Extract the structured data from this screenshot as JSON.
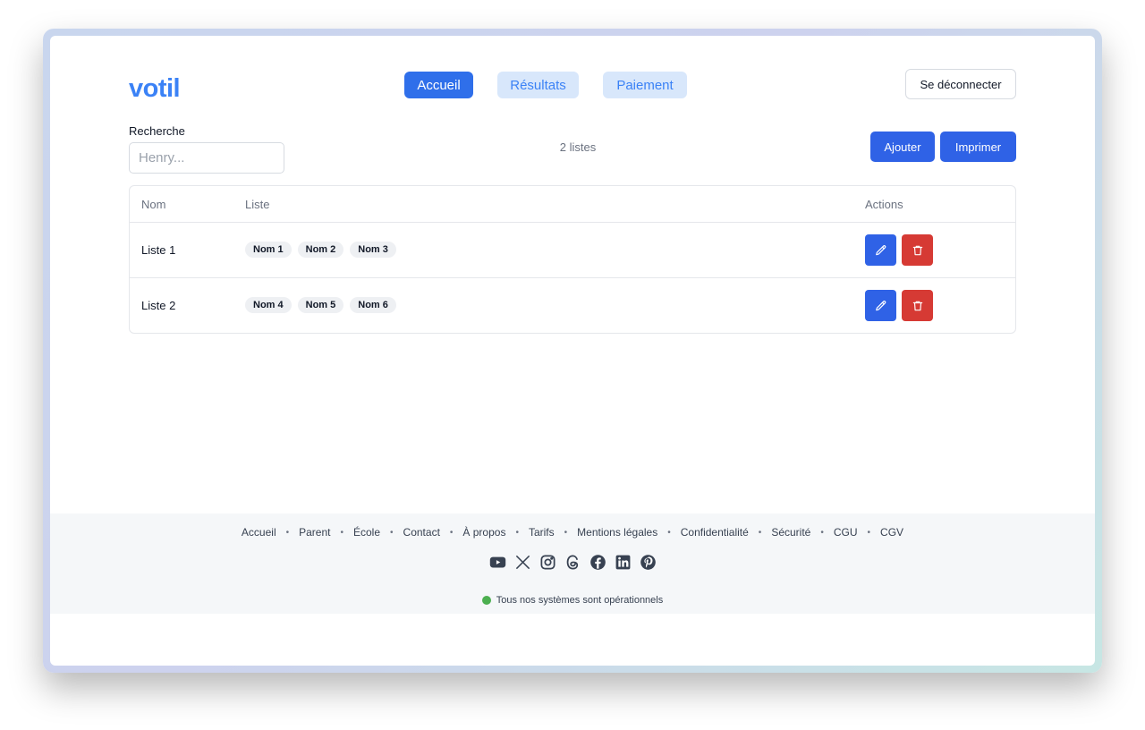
{
  "header": {
    "logo": "votil",
    "nav": [
      {
        "label": "Accueil",
        "active": true
      },
      {
        "label": "Résultats",
        "active": false
      },
      {
        "label": "Paiement",
        "active": false
      }
    ],
    "logout_label": "Se déconnecter"
  },
  "toolbar": {
    "search_label": "Recherche",
    "search_placeholder": "Henry...",
    "count_text": "2 listes",
    "add_label": "Ajouter",
    "print_label": "Imprimer"
  },
  "table": {
    "columns": [
      "Nom",
      "Liste",
      "Actions"
    ],
    "rows": [
      {
        "name": "Liste 1",
        "members": [
          "Nom 1",
          "Nom 2",
          "Nom 3"
        ]
      },
      {
        "name": "Liste 2",
        "members": [
          "Nom 4",
          "Nom 5",
          "Nom 6"
        ]
      }
    ]
  },
  "footer": {
    "links": [
      "Accueil",
      "Parent",
      "École",
      "Contact",
      "À propos",
      "Tarifs",
      "Mentions légales",
      "Confidentialité",
      "Sécurité",
      "CGU",
      "CGV"
    ],
    "social_icons": [
      "youtube-icon",
      "x-icon",
      "instagram-icon",
      "threads-icon",
      "facebook-icon",
      "linkedin-icon",
      "pinterest-icon"
    ],
    "status_text": "Tous nos systèmes sont opérationnels"
  },
  "colors": {
    "brand": "#3b82f6",
    "primary": "#2f62e6",
    "danger": "#d63a34",
    "status_ok": "#4caf50"
  }
}
